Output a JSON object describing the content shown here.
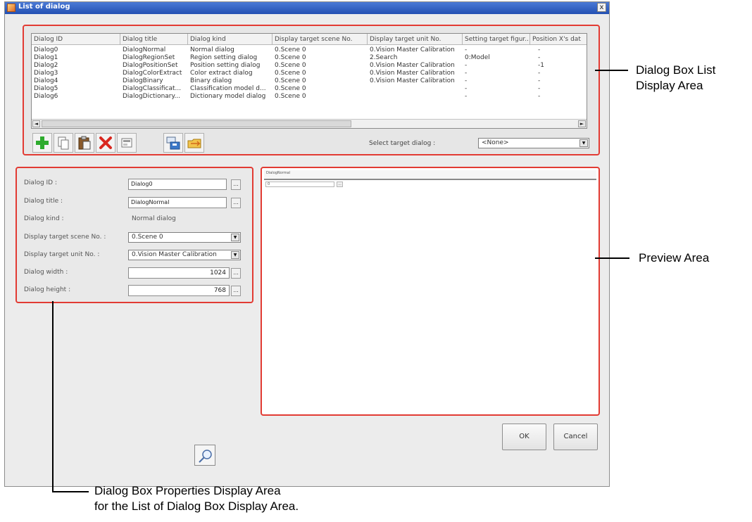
{
  "window": {
    "title": "List of dialog",
    "close_symbol": "x"
  },
  "list": {
    "columns": [
      "Dialog ID",
      "Dialog title",
      "Dialog kind",
      "Display target scene No.",
      "Display target unit No.",
      "Setting target figur...",
      "Position X's dat"
    ],
    "rows": [
      [
        "Dialog0",
        "DialogNormal",
        "Normal dialog",
        "0.Scene 0",
        "0.Vision Master Calibration",
        "-",
        "-"
      ],
      [
        "Dialog1",
        "DialogRegionSet",
        "Region setting dialog",
        "0.Scene 0",
        "2.Search",
        "0:Model",
        "-"
      ],
      [
        "Dialog2",
        "DialogPositionSet",
        "Position setting dialog",
        "0.Scene 0",
        "0.Vision Master Calibration",
        "-",
        "-1"
      ],
      [
        "Dialog3",
        "DialogColorExtract",
        "Color extract dialog",
        "0.Scene 0",
        "0.Vision Master Calibration",
        "-",
        "-"
      ],
      [
        "Dialog4",
        "DialogBinary",
        "Binary dialog",
        "0.Scene 0",
        "0.Vision Master Calibration",
        "-",
        "-"
      ],
      [
        "Dialog5",
        "DialogClassificat...",
        "Classification model d...",
        "0.Scene 0",
        "",
        "-",
        "-"
      ],
      [
        "Dialog6",
        "DialogDictionary...",
        "Dictionary model dialog",
        "0.Scene 0",
        "",
        "-",
        "-"
      ]
    ],
    "scroll_left": "◄",
    "scroll_right": "►",
    "select_label": "Select target dialog :",
    "select_value": "<None>",
    "dropdown_arrow": "▼"
  },
  "props": {
    "dialog_id_label": "Dialog ID :",
    "dialog_id_value": "Dialog0",
    "dialog_title_label": "Dialog title :",
    "dialog_title_value": "DialogNormal",
    "dialog_kind_label": "Dialog kind :",
    "dialog_kind_value": "Normal dialog",
    "scene_label": "Display target scene No. :",
    "scene_value": "0.Scene 0",
    "unit_label": "Display target unit No. :",
    "unit_value": "0.Vision Master Calibration",
    "width_label": "Dialog width :",
    "width_value": "1024",
    "height_label": "Dialog height :",
    "height_value": "768",
    "ellipsis": "..."
  },
  "preview": {
    "title": "DialogNormal",
    "field_value": "0",
    "button": "..."
  },
  "buttons": {
    "ok": "OK",
    "cancel": "Cancel"
  },
  "callouts": {
    "list_line1": "Dialog Box List",
    "list_line2": "Display Area",
    "preview": "Preview Area",
    "props_line1": "Dialog Box Properties Display Area",
    "props_line2": "for the List of Dialog Box Display Area."
  },
  "colors": {
    "highlight": "#e23b33",
    "titlebar": "#2f5fc4",
    "add_icon": "#2eab2e",
    "delete_icon": "#d9271f"
  },
  "icons": [
    "add-icon",
    "copy-icon",
    "paste-icon",
    "delete-icon",
    "properties-icon",
    "export-icon",
    "import-icon",
    "preview-zoom-icon"
  ]
}
